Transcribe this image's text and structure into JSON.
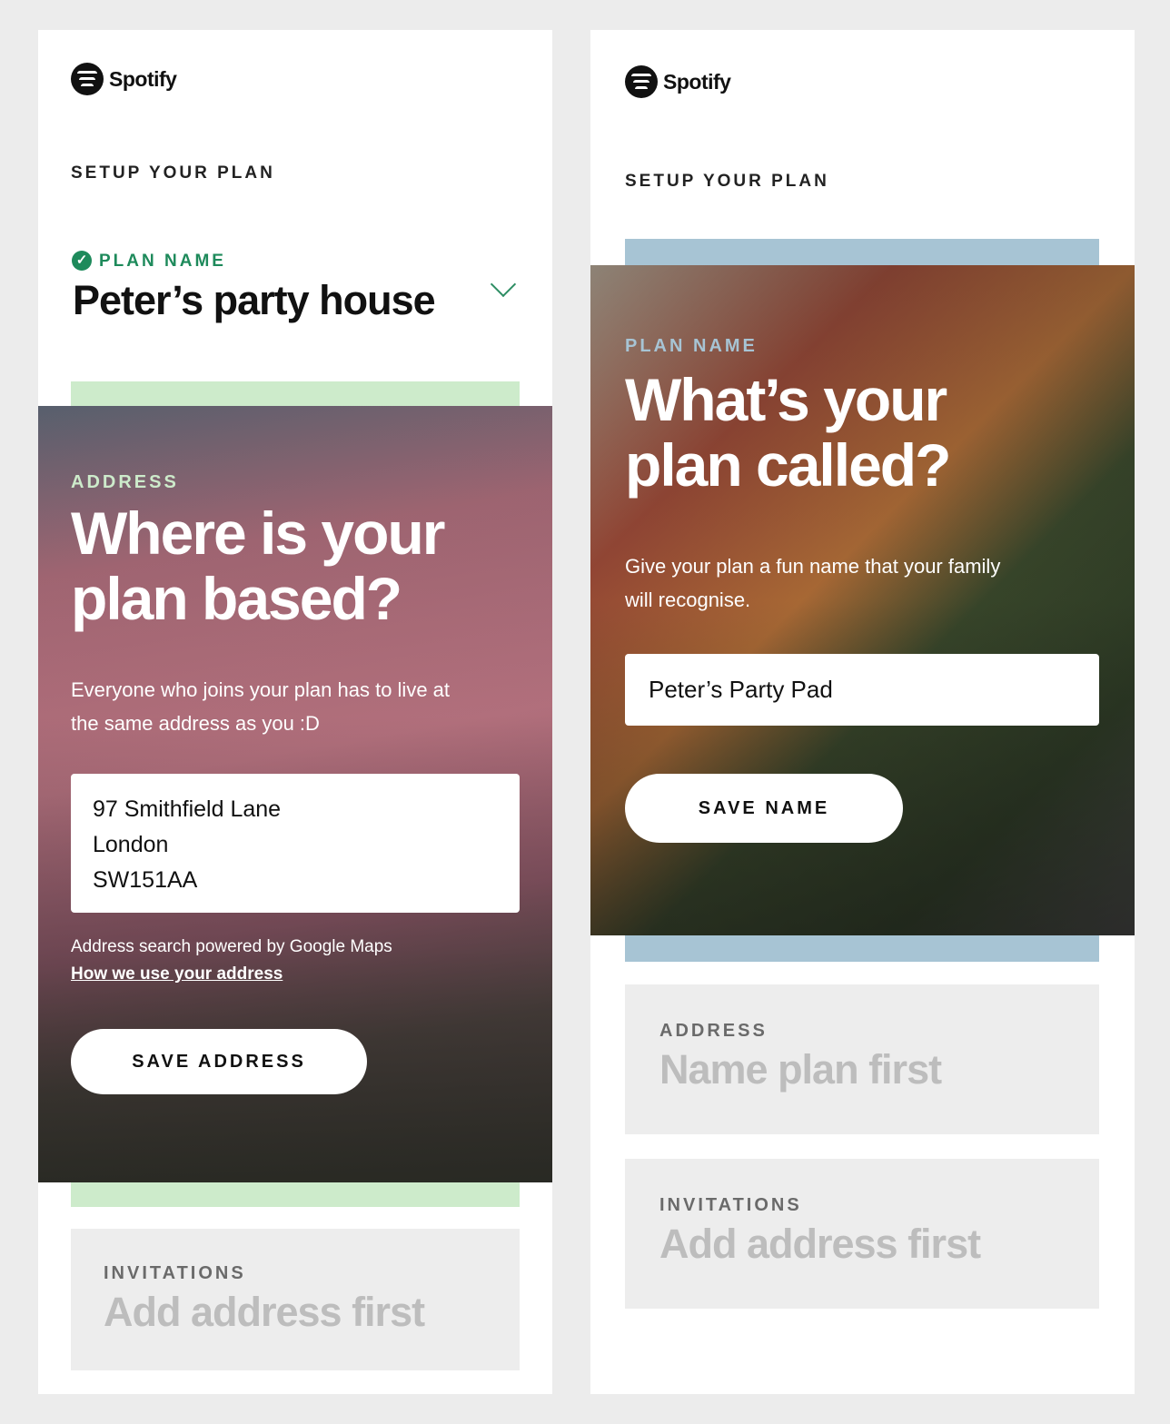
{
  "colors": {
    "success_green": "#1e8a5b",
    "left_accent": "#cdebcb",
    "right_accent": "#a7c4d4",
    "left_label_color": "#cdebcb",
    "right_label_color": "#a7c4d4",
    "locked_bg": "#ededed"
  },
  "left": {
    "logo_text": "Spotify",
    "step_heading": "SETUP YOUR PLAN",
    "plan_name": {
      "label": "PLAN NAME",
      "value": "Peter’s party house",
      "icon": "check-circle-icon",
      "toggle_icon": "chevron-down-icon"
    },
    "address_step": {
      "label": "ADDRESS",
      "title_line1": "Where is your",
      "title_line2": "plan based?",
      "desc_line1": "Everyone who joins your plan has to live at",
      "desc_line2": "the same address as you :D",
      "address_lines": [
        "97 Smithfield Lane",
        "London",
        "SW151AA"
      ],
      "powered_by": "Address search powered by Google Maps",
      "privacy_link": "How we use your address",
      "save_button": "SAVE ADDRESS"
    },
    "invitations": {
      "label": "INVITATIONS",
      "value": "Add address first"
    }
  },
  "right": {
    "logo_text": "Spotify",
    "step_heading": "SETUP YOUR PLAN",
    "plan_name_step": {
      "label": "PLAN NAME",
      "title_line1": "What’s your",
      "title_line2": "plan called?",
      "desc_line1": "Give your plan a fun name that your family",
      "desc_line2": "will recognise.",
      "input_value": "Peter’s Party Pad",
      "save_button": "SAVE NAME"
    },
    "address": {
      "label": "ADDRESS",
      "value": "Name plan first"
    },
    "invitations": {
      "label": "INVITATIONS",
      "value": "Add address first"
    }
  }
}
